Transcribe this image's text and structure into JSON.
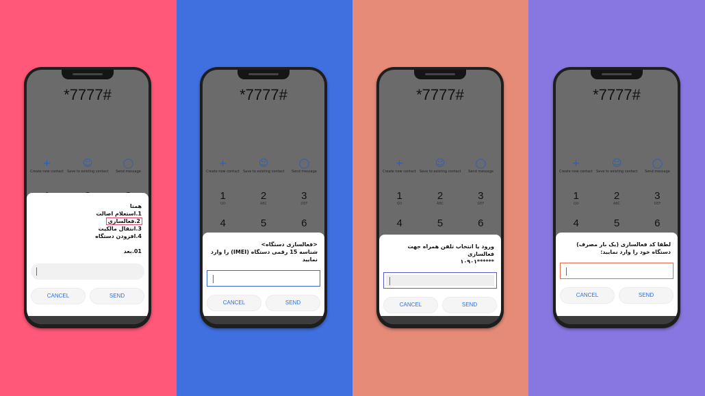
{
  "colors": {
    "panels": [
      "#ff5878",
      "#4070e0",
      "#e58b78",
      "#8877e0"
    ],
    "accent": "#2f6fe0"
  },
  "dialer": {
    "number": "*7777#",
    "actions": [
      {
        "label": "Create new contact",
        "icon": "plus-icon"
      },
      {
        "label": "Save to existing contact",
        "icon": "person-icon"
      },
      {
        "label": "Send message",
        "icon": "message-icon"
      }
    ],
    "keys": [
      {
        "d": "1",
        "l": "QO"
      },
      {
        "d": "2",
        "l": "ABC"
      },
      {
        "d": "3",
        "l": "DEF"
      },
      {
        "d": "4",
        "l": ""
      },
      {
        "d": "5",
        "l": ""
      },
      {
        "d": "6",
        "l": ""
      }
    ]
  },
  "phones": [
    {
      "lines": [
        "همتا",
        "1.استعلام اصالت",
        "2.فعالسازی",
        "3.انتقال مالکیت",
        "4.افزودن دستگاه",
        "",
        "01.بعد"
      ],
      "highlight_line": 2,
      "cancel": "CANCEL",
      "send": "SEND"
    },
    {
      "lines": [
        "<فعالسازی دستگاه>",
        "شناسه 15 رقمی دستگاه (IMEI) را وارد نمایید"
      ],
      "cancel": "CANCEL",
      "send": "SEND"
    },
    {
      "lines": [
        "ورود یا انتخاب تلفن همراه جهت فعالسازی",
        "******۱۰۹۰۱"
      ],
      "cancel": "CANCEL",
      "send": "SEND"
    },
    {
      "lines": [
        "لطفا کد فعالسازی (یک بار مصرف) دستگاه خود را وارد نمایید:"
      ],
      "cancel": "CANCEL",
      "send": "SEND"
    }
  ]
}
